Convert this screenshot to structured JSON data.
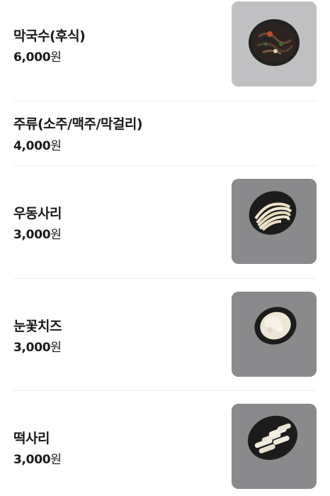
{
  "menu": {
    "items": [
      {
        "name": "막국수(후식)",
        "price": "6,000",
        "currency": "원",
        "photo": "bowl-of-cold-buckwheat-noodles"
      },
      {
        "name": "주류(소주/맥주/막걸리)",
        "price": "4,000",
        "currency": "원",
        "photo": ""
      },
      {
        "name": "우동사리",
        "price": "3,000",
        "currency": "원",
        "photo": "udon-noodles-on-black-plate"
      },
      {
        "name": "눈꽃치즈",
        "price": "3,000",
        "currency": "원",
        "photo": "shredded-cheese-on-black-plate"
      },
      {
        "name": "떡사리",
        "price": "3,000",
        "currency": "원",
        "photo": "rice-cakes-on-black-plate"
      }
    ]
  },
  "colors": {
    "text": "#1a1a1a",
    "divider": "#eeeeee",
    "photo_background": "#8c8c8c"
  }
}
